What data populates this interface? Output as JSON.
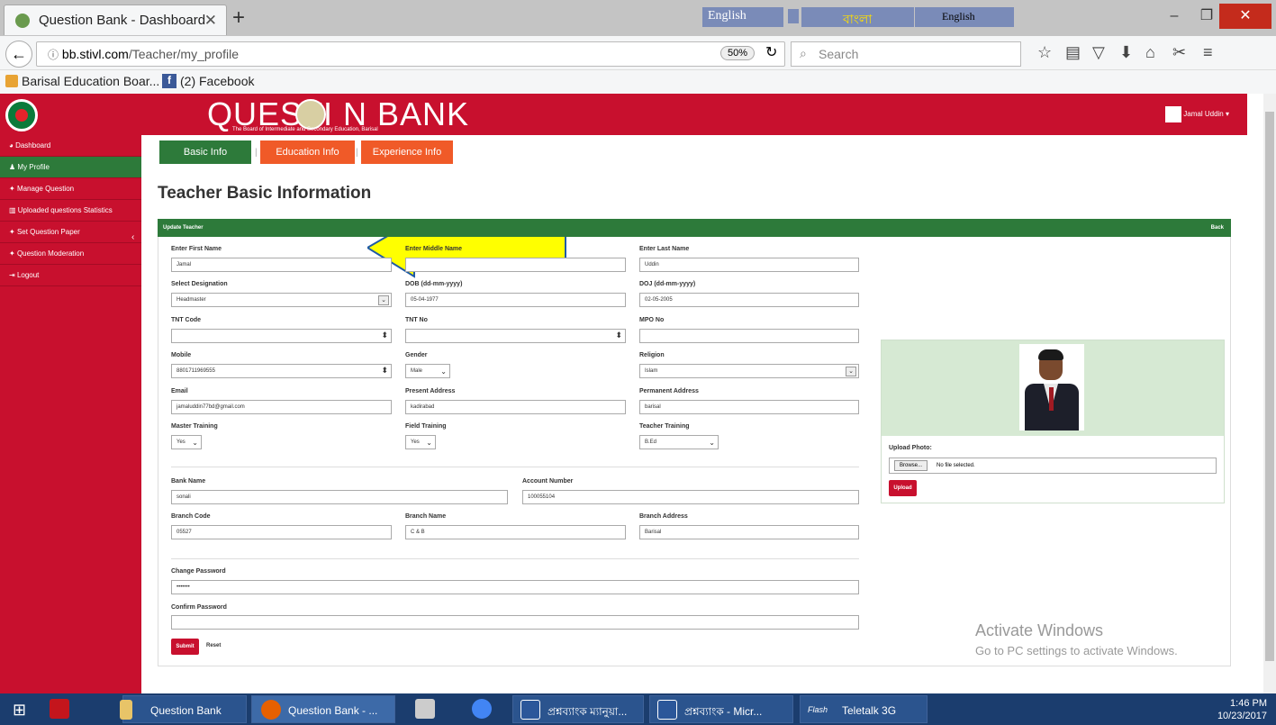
{
  "browser": {
    "tab_title": "Question Bank - Dashboard",
    "url_prefix": "bb.stivl.com",
    "url_path": "/Teacher/my_profile",
    "zoom": "50%",
    "search_placeholder": "Search",
    "ext_english1": "English",
    "ext_bangla": "বাংলা",
    "ext_english2": "English",
    "bookmarks": [
      "Barisal Education Boar...",
      "(2) Facebook"
    ]
  },
  "app": {
    "brand": "QUESTI N BANK",
    "brand_sub": "The Board of Intermediate and Secondary Education, Barisal",
    "user": "Jamal Uddin",
    "title": "Teacher Basic Information",
    "panel_title": "Update Teacher",
    "back_label": "Back"
  },
  "sidebar": {
    "items": [
      "Dashboard",
      "My Profile",
      "Manage Question",
      "Uploaded questions Statistics",
      "Set Question Paper",
      "Question Moderation",
      "Logout"
    ]
  },
  "tabs": [
    "Basic Info",
    "Education Info",
    "Experience Info"
  ],
  "form": {
    "first_name_label": "Enter First Name",
    "first_name": "Jamal",
    "middle_name_label": "Enter Middle Name",
    "middle_name": "",
    "last_name_label": "Enter Last Name",
    "last_name": "Uddin",
    "designation_label": "Select Designation",
    "designation": "Headmaster",
    "dob_label": "DOB (dd-mm-yyyy)",
    "dob": "05-04-1977",
    "doj_label": "DOJ (dd-mm-yyyy)",
    "doj": "02-05-2005",
    "tnt_code_label": "TNT Code",
    "tnt_no_label": "TNT No",
    "mpo_label": "MPO No",
    "mobile_label": "Mobile",
    "mobile": "8801711969555",
    "gender_label": "Gender",
    "gender": "Male",
    "religion_label": "Religion",
    "religion": "Islam",
    "email_label": "Email",
    "email": "jamaluddin77bd@gmail.com",
    "present_label": "Present Address",
    "present": "kadirabad",
    "permanent_label": "Permanent Address",
    "permanent": "barisal",
    "master_label": "Master Training",
    "master": "Yes",
    "field_label": "Field Training",
    "field": "Yes",
    "teacher_label": "Teacher Training",
    "teacher": "B.Ed",
    "bank_label": "Bank Name",
    "bank": "sonali",
    "account_label": "Account Number",
    "account": "100055104",
    "branch_code_label": "Branch Code",
    "branch_code": "05527",
    "branch_name_label": "Branch Name",
    "branch_name": "C & B",
    "branch_addr_label": "Branch Address",
    "branch_addr": "Barisal",
    "change_pw_label": "Change Password",
    "change_pw": "•••••••",
    "confirm_pw_label": "Confirm Password",
    "submit": "Submit",
    "reset": "Reset"
  },
  "photo": {
    "upload_label": "Upload Photo:",
    "browse": "Browse...",
    "no_file": "No file selected.",
    "upload_btn": "Upload"
  },
  "watermark": {
    "line1": "Activate Windows",
    "line2": "Go to PC settings to activate Windows."
  },
  "taskbar": {
    "items": [
      "Question Bank",
      "Question Bank - ...",
      "প্রশ্নব্যাংক ম্যানুয়া...",
      "প্রশ্নব্যাংক - Micr...",
      "Teletalk 3G"
    ],
    "time": "1:46 PM",
    "date": "10/23/2017"
  },
  "colors": {
    "brand_red": "#c8102e",
    "green": "#2d7a3a",
    "orange": "#f05a28"
  }
}
